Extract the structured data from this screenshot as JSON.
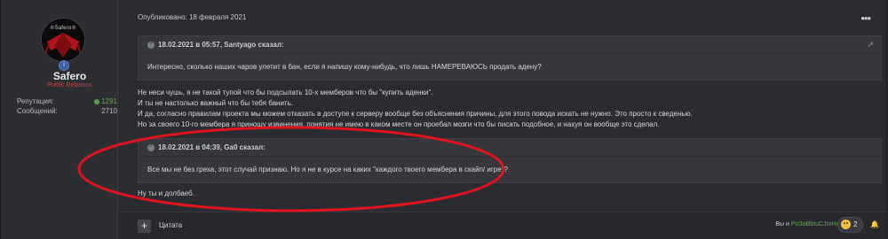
{
  "author": {
    "avatar_tag": "♔Safero♔",
    "rank_icon": "info-badge",
    "username": "Safero",
    "usergroup": "Public Relations",
    "reputation_label": "Репутация:",
    "reputation_value": "1291",
    "messages_label": "Сообщений:",
    "messages_value": "2710"
  },
  "post": {
    "published": "Опубликовано: 18 февраля 2021",
    "quote1": {
      "header": "18.02.2021 в 05:57, Santyago сказал:",
      "text": "Интересно, сколько наших чаров улетит в бан, если я напишу кому-нибудь, что лишь НАМЕРЕВАЮСЬ продать адену?"
    },
    "lines": [
      "Не неси чушь, я не такой тупой что бы подсылать 10-х мемберов что бы \"купить аденки\".",
      "И ты не настолько важный что бы тебя банить.",
      "И да, согласно правилам проекта мы можем отказать в доступе к серверу вообще без объяснения причины, для этого повода искать не нужно. Это просто к сведенью.",
      "Но за своего 10-го мембера я приношу извинения, понятия не имею в каком месте он проебал мозги что бы писать подобное, и нахуя он вообще это сделал."
    ],
    "quote2": {
      "header": "18.02.2021 в 04:39, Ga0 сказал:",
      "text": "Все мы не без греха, этот случай признаю. Но я не в курсе на каких \"каждого твоего мембера в скайп/ игре\"?"
    },
    "final_line": "Ну ты и долбаеб."
  },
  "footer": {
    "plus_label": "+",
    "quote_label": "Цитата",
    "likes_prefix": "Вы и",
    "likes_user": "PoЗoBbIuCJIoHuK",
    "reaction_count": "2"
  },
  "colors": {
    "background": "#2b2c30",
    "quote_bg": "#36373b",
    "usergroup": "#c8413d",
    "reputation": "#6aa05a",
    "annotation": "#e0141c"
  }
}
